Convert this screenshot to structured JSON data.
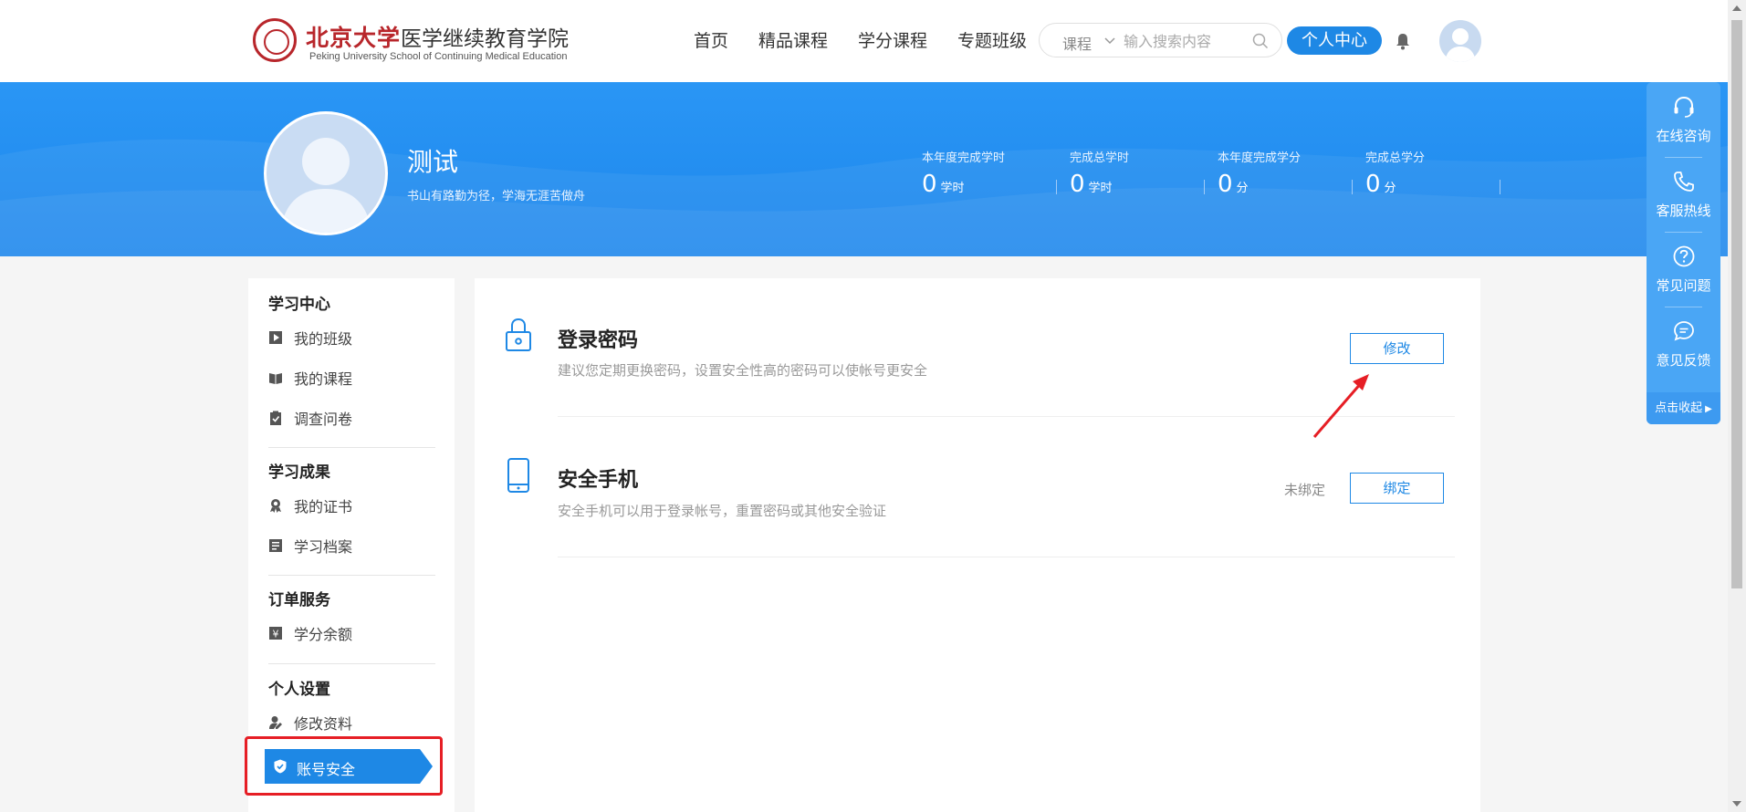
{
  "header": {
    "logo_cn_main": "北京大学",
    "logo_cn_sub": "医学继续教育学院",
    "logo_en": "Peking University School of Continuing Medical Education",
    "nav": [
      "首页",
      "精品课程",
      "学分课程",
      "专题班级"
    ],
    "search": {
      "category": "课程",
      "placeholder": "输入搜索内容"
    },
    "personal_center": "个人中心"
  },
  "profile": {
    "name": "测试",
    "motto": "书山有路勤为径，学海无涯苦做舟",
    "stats": [
      {
        "label": "本年度完成学时",
        "value": "0",
        "unit": "学时"
      },
      {
        "label": "完成总学时",
        "value": "0",
        "unit": "学时"
      },
      {
        "label": "本年度完成学分",
        "value": "0",
        "unit": "分"
      },
      {
        "label": "完成总学分",
        "value": "0",
        "unit": "分"
      }
    ]
  },
  "sidebar": {
    "sections": [
      {
        "title": "学习中心",
        "items": [
          "我的班级",
          "我的课程",
          "调查问卷"
        ]
      },
      {
        "title": "学习成果",
        "items": [
          "我的证书",
          "学习档案"
        ]
      },
      {
        "title": "订单服务",
        "items": [
          "学分余额"
        ]
      },
      {
        "title": "个人设置",
        "items": [
          "修改资料",
          "账号安全"
        ]
      }
    ]
  },
  "security": {
    "password": {
      "title": "登录密码",
      "desc": "建议您定期更换密码，设置安全性高的密码可以使帐号更安全",
      "button": "修改"
    },
    "phone": {
      "title": "安全手机",
      "desc": "安全手机可以用于登录帐号，重置密码或其他安全验证",
      "status": "未绑定",
      "button": "绑定"
    }
  },
  "float_panel": {
    "items": [
      "在线咨询",
      "客服热线",
      "常见问题",
      "意见反馈"
    ],
    "collapse": "点击收起"
  },
  "colors": {
    "primary": "#1e88e5",
    "highlight": "#e61e25",
    "brand_red": "#b8262b"
  }
}
